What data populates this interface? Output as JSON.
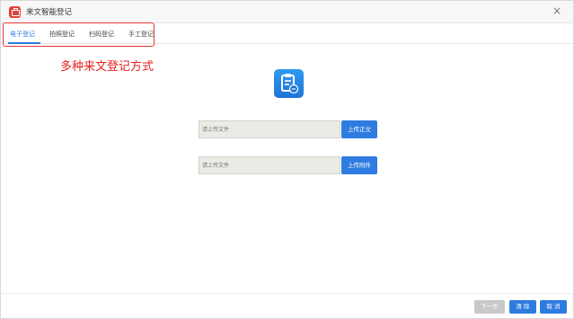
{
  "window": {
    "title": "来文智能登记",
    "close_glyph": "×"
  },
  "tabs": [
    {
      "label": "电子登记",
      "active": true
    },
    {
      "label": "拍照登记",
      "active": false
    },
    {
      "label": "扫码登记",
      "active": false
    },
    {
      "label": "手工登记",
      "active": false
    }
  ],
  "annotation": {
    "text": "多种来文登记方式"
  },
  "icons": {
    "app": "briefcase-icon",
    "doc": "clipboard-document-icon",
    "close": "close-icon"
  },
  "upload": {
    "main": {
      "placeholder": "请上传文件",
      "value": "",
      "button": "上传正文"
    },
    "attachment": {
      "placeholder": "请上传文件",
      "value": "",
      "button": "上传附件"
    }
  },
  "footer": {
    "next": "下一步",
    "clear": "清 除",
    "cancel": "取 消"
  },
  "colors": {
    "accent": "#2f7ce0",
    "annotation": "#e5211f",
    "disabled": "#c9c9c9",
    "app_icon": "#e0433b"
  }
}
